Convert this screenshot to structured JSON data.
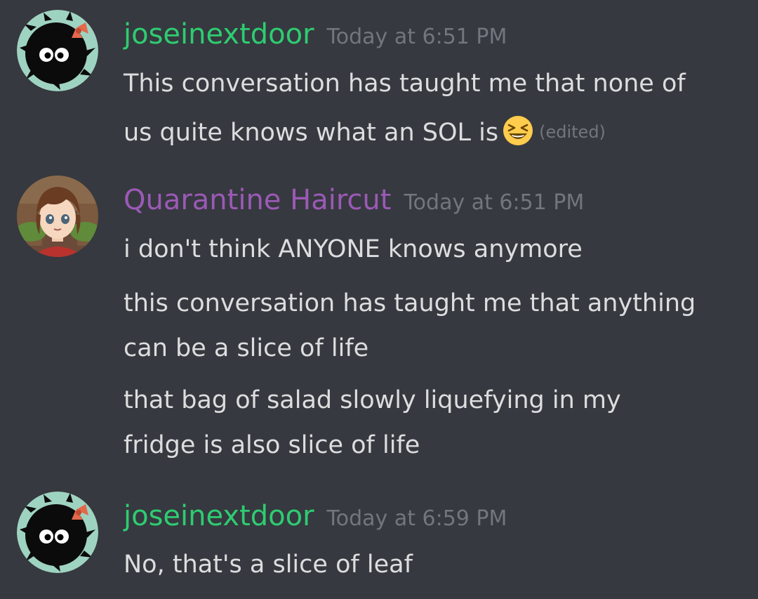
{
  "messages": [
    {
      "author": "joseinextdoor",
      "author_color": "#2ecc71",
      "avatar_icon": "soot-sprite-avatar-icon",
      "timestamp": "Today at 6:51 PM",
      "lines": [
        "This conversation has taught me that none of",
        "us quite knows what an SOL is"
      ],
      "emoji": "laughing-emoji-icon",
      "edited_label": "(edited)"
    },
    {
      "author": "Quarantine Haircut",
      "author_color": "#9b59b6",
      "avatar_icon": "anime-girl-avatar-icon",
      "timestamp": "Today at 6:51 PM",
      "lines": [
        "i don't think ANYONE knows anymore",
        "this conversation has taught me that anything",
        "can be a slice of life",
        "that bag of salad slowly liquefying in my",
        "fridge is also slice of life"
      ]
    },
    {
      "author": "joseinextdoor",
      "author_color": "#2ecc71",
      "avatar_icon": "soot-sprite-avatar-icon",
      "timestamp": "Today at 6:59 PM",
      "lines": [
        "No, that's a slice of leaf"
      ]
    }
  ],
  "colors": {
    "background": "#36393f",
    "text": "#dcddde",
    "muted": "#72767d"
  }
}
